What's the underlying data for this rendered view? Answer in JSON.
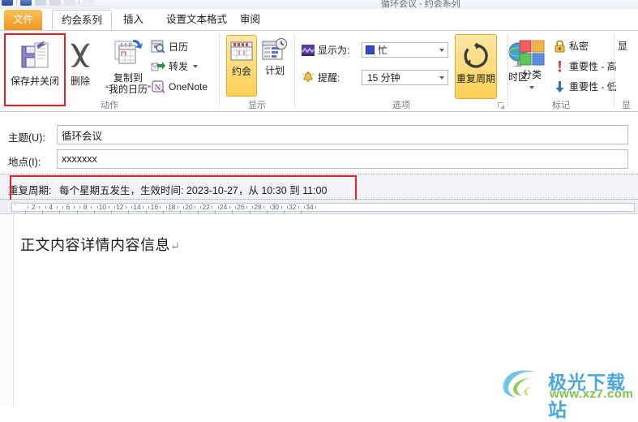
{
  "window": {
    "title": "循环会议  -  约会系列",
    "quick_access": [
      "save-icon",
      "undo-icon",
      "redo-icon",
      "previous-item-icon",
      "next-item-icon",
      "customize-qat-icon"
    ]
  },
  "tabs": [
    {
      "label": "文件",
      "name": "tab-file",
      "active": false
    },
    {
      "label": "约会系列",
      "name": "tab-appointment-series",
      "active": true
    },
    {
      "label": "插入",
      "name": "tab-insert",
      "active": false
    },
    {
      "label": "设置文本格式",
      "name": "tab-format-text",
      "active": false
    },
    {
      "label": "审阅",
      "name": "tab-review",
      "active": false
    }
  ],
  "ribbon": {
    "groups": [
      {
        "name": "actions",
        "label": "动作",
        "buttons": [
          {
            "label": "保存并关闭",
            "icon": "save-and-close-icon"
          },
          {
            "label": "删除",
            "icon": "delete-x-icon"
          },
          {
            "label": "复制到“我的日历”",
            "line1": "复制到",
            "line2": "“我的日历”",
            "icon": "copy-to-calendar-icon"
          },
          {
            "label": "日历",
            "icon": "calendar-search-icon"
          },
          {
            "label": "转发",
            "icon": "forward-icon",
            "has_dropdown": true
          },
          {
            "label": "OneNote",
            "icon": "onenote-icon"
          }
        ]
      },
      {
        "name": "show",
        "label": "显示",
        "buttons": [
          {
            "label": "约会",
            "icon": "appointment-icon",
            "selected": true
          },
          {
            "label": "计划",
            "icon": "scheduling-icon",
            "selected": false
          }
        ]
      },
      {
        "name": "options",
        "label": "选项",
        "show_as_label": "显示为:",
        "show_as_value": "忙",
        "show_as_icon": "show-as-icon",
        "show_as_swatch": "#3b49c9",
        "reminder_label": "提醒:",
        "reminder_value": "15 分钟",
        "reminder_icon": "reminder-bell-icon",
        "recurrence_label": "重复周期",
        "recurrence_icon": "recurrence-icon",
        "recurrence_selected": true,
        "timezone_label": "时区",
        "timezone_icon": "globe-icon"
      },
      {
        "name": "tags",
        "label": "标记",
        "categorize_label": "分类",
        "categorize_icon": "categorize-colors-icon",
        "items": [
          {
            "label": "私密",
            "icon": "lock-icon"
          },
          {
            "label": "重要性 - 高",
            "icon": "high-importance-icon"
          },
          {
            "label": "重要性 - 低",
            "icon": "low-importance-icon"
          }
        ]
      },
      {
        "name": "zoom-cut",
        "label": "显",
        "item_label": "显"
      }
    ]
  },
  "form": {
    "subject_label": "主题(U):",
    "subject_value": "循环会议",
    "location_label": "地点(I):",
    "location_value": "xxxxxxx",
    "recurrence_label": "重复周期:",
    "recurrence_value": "每个星期五发生，生效时间: 2023-10-27，从 10:30 到 11:00"
  },
  "ruler": {
    "ticks": [
      2,
      4,
      6,
      8,
      10,
      12,
      14,
      16,
      18,
      20,
      22,
      24,
      26,
      28,
      30,
      32,
      34
    ]
  },
  "body": {
    "text": "正文内容详情内容信息",
    "paragraph_mark": "↵"
  },
  "highlights": {
    "color": "#ee1c25",
    "regions": [
      "save-and-close-button",
      "recurrence-summary-row"
    ]
  },
  "watermark": {
    "name_cn": "极光下载站",
    "url": "www.xz7.com",
    "color_cn": "#4aa8e0",
    "color_url": "#7ec24a"
  }
}
